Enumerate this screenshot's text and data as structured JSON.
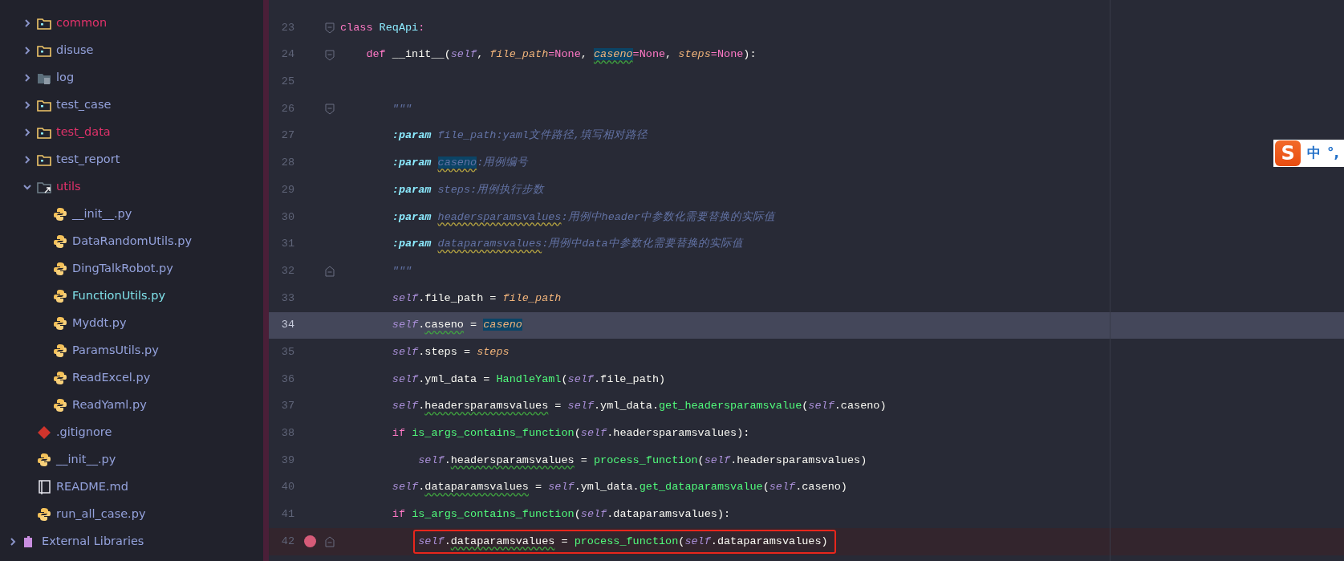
{
  "project_tree": {
    "items": [
      {
        "label": "common",
        "kind": "folder",
        "expanded": false,
        "color": "#e0326a"
      },
      {
        "label": "disuse",
        "kind": "folder",
        "expanded": false,
        "color": "#94a2dc"
      },
      {
        "label": "log",
        "kind": "excluded-folder",
        "expanded": false,
        "color": "#94a2dc"
      },
      {
        "label": "test_case",
        "kind": "folder",
        "expanded": false,
        "color": "#94a2dc"
      },
      {
        "label": "test_data",
        "kind": "folder",
        "expanded": false,
        "color": "#e0326a"
      },
      {
        "label": "test_report",
        "kind": "folder",
        "expanded": false,
        "color": "#94a2dc"
      },
      {
        "label": "utils",
        "kind": "package",
        "expanded": true,
        "color": "#e0326a",
        "children": [
          {
            "label": "__init__.py",
            "kind": "python",
            "color": "#94a2dc"
          },
          {
            "label": "DataRandomUtils.py",
            "kind": "python",
            "color": "#94a2dc"
          },
          {
            "label": "DingTalkRobot.py",
            "kind": "python",
            "color": "#94a2dc"
          },
          {
            "label": "FunctionUtils.py",
            "kind": "python",
            "color": "#7fe0e8"
          },
          {
            "label": "Myddt.py",
            "kind": "python",
            "color": "#94a2dc"
          },
          {
            "label": "ParamsUtils.py",
            "kind": "python",
            "color": "#94a2dc"
          },
          {
            "label": "ReadExcel.py",
            "kind": "python",
            "color": "#94a2dc"
          },
          {
            "label": "ReadYaml.py",
            "kind": "python",
            "color": "#94a2dc"
          }
        ]
      },
      {
        "label": ".gitignore",
        "kind": "git",
        "color": "#94a2dc"
      },
      {
        "label": "__init__.py",
        "kind": "python",
        "color": "#94a2dc"
      },
      {
        "label": "README.md",
        "kind": "markdown",
        "color": "#94a2dc"
      },
      {
        "label": "run_all_case.py",
        "kind": "python",
        "color": "#94a2dc"
      }
    ],
    "external_libraries": {
      "label": "External Libraries",
      "expanded": false
    }
  },
  "editor": {
    "lines": [
      {
        "number": "23",
        "fold_start": true,
        "tokens": [
          {
            "text": "class ",
            "kind": "keyword"
          },
          {
            "text": "ReqApi",
            "kind": "class"
          },
          {
            "text": ":",
            "kind": "keyword"
          }
        ]
      },
      {
        "number": "24",
        "fold_start": true,
        "tokens": [
          {
            "text": "    def",
            "kind": "keyword"
          },
          {
            "text": " __init__(",
            "kind": "plain"
          },
          {
            "text": "self",
            "kind": "self"
          },
          {
            "text": ", ",
            "kind": "plain"
          },
          {
            "text": "file_path",
            "kind": "param"
          },
          {
            "text": "=None",
            "kind": "keyword"
          },
          {
            "text": ", ",
            "kind": "plain"
          },
          {
            "text": "caseno",
            "kind": "param",
            "match": true,
            "squiggle": true
          },
          {
            "text": "=None",
            "kind": "keyword"
          },
          {
            "text": ", ",
            "kind": "plain"
          },
          {
            "text": "steps",
            "kind": "param"
          },
          {
            "text": "=None",
            "kind": "keyword"
          },
          {
            "text": "):",
            "kind": "plain"
          }
        ]
      },
      {
        "number": "25"
      },
      {
        "number": "26",
        "fold_start": true,
        "tokens": [
          {
            "text": "        \"\"\"",
            "kind": "doc"
          }
        ]
      },
      {
        "number": "27",
        "tokens": [
          {
            "text": "        :param",
            "kind": "doctag"
          },
          {
            "text": " file_path:yaml文件路径,填写相对路径",
            "kind": "doc"
          }
        ]
      },
      {
        "number": "28",
        "tokens": [
          {
            "text": "        :param ",
            "kind": "doctag"
          },
          {
            "text": "caseno",
            "kind": "doc",
            "match": true,
            "squiggle": true
          },
          {
            "text": ":用例编号",
            "kind": "doc"
          }
        ]
      },
      {
        "number": "29",
        "tokens": [
          {
            "text": "        :param",
            "kind": "doctag"
          },
          {
            "text": " steps:用例执行步数",
            "kind": "doc"
          }
        ]
      },
      {
        "number": "30",
        "tokens": [
          {
            "text": "        :param ",
            "kind": "doctag"
          },
          {
            "text": "headersparamsvalues",
            "kind": "doc",
            "squiggle": true
          },
          {
            "text": ":用例中header中参数化需要替换的实际值",
            "kind": "doc"
          }
        ]
      },
      {
        "number": "31",
        "tokens": [
          {
            "text": "        :param ",
            "kind": "doctag"
          },
          {
            "text": "dataparamsvalues",
            "kind": "doc",
            "squiggle": true
          },
          {
            "text": ":用例中data中参数化需要替换的实际值",
            "kind": "doc"
          }
        ]
      },
      {
        "number": "32",
        "fold_end": true,
        "tokens": [
          {
            "text": "        \"\"\"",
            "kind": "doc"
          }
        ]
      },
      {
        "number": "33",
        "tokens": [
          {
            "text": "        self",
            "kind": "self"
          },
          {
            "text": ".file_path = ",
            "kind": "plain"
          },
          {
            "text": "file_path",
            "kind": "param"
          }
        ]
      },
      {
        "number": "34",
        "current": true,
        "tokens": [
          {
            "text": "        self",
            "kind": "self"
          },
          {
            "text": ".",
            "kind": "plain"
          },
          {
            "text": "caseno",
            "kind": "plain",
            "squiggle": true
          },
          {
            "text": " = ",
            "kind": "plain"
          },
          {
            "text": "caseno",
            "kind": "param",
            "match": true
          }
        ]
      },
      {
        "number": "35",
        "tokens": [
          {
            "text": "        self",
            "kind": "self"
          },
          {
            "text": ".steps = ",
            "kind": "plain"
          },
          {
            "text": "steps",
            "kind": "param"
          }
        ]
      },
      {
        "number": "36",
        "tokens": [
          {
            "text": "        self",
            "kind": "self"
          },
          {
            "text": ".yml_data = ",
            "kind": "plain"
          },
          {
            "text": "HandleYaml",
            "kind": "function"
          },
          {
            "text": "(",
            "kind": "plain"
          },
          {
            "text": "self",
            "kind": "self"
          },
          {
            "text": ".file_path)",
            "kind": "plain"
          }
        ]
      },
      {
        "number": "37",
        "tokens": [
          {
            "text": "        self",
            "kind": "self"
          },
          {
            "text": ".",
            "kind": "plain"
          },
          {
            "text": "headersparamsvalues",
            "kind": "plain",
            "squiggle": true
          },
          {
            "text": " = ",
            "kind": "plain"
          },
          {
            "text": "self",
            "kind": "self"
          },
          {
            "text": ".yml_data.",
            "kind": "plain"
          },
          {
            "text": "get_headersparamsvalue",
            "kind": "function"
          },
          {
            "text": "(",
            "kind": "plain"
          },
          {
            "text": "self",
            "kind": "self"
          },
          {
            "text": ".caseno)",
            "kind": "plain"
          }
        ]
      },
      {
        "number": "38",
        "tokens": [
          {
            "text": "        if ",
            "kind": "keyword"
          },
          {
            "text": "is_args_contains_function",
            "kind": "function"
          },
          {
            "text": "(",
            "kind": "plain"
          },
          {
            "text": "self",
            "kind": "self"
          },
          {
            "text": ".headersparamsvalues):",
            "kind": "plain"
          }
        ]
      },
      {
        "number": "39",
        "tokens": [
          {
            "text": "            self",
            "kind": "self"
          },
          {
            "text": ".",
            "kind": "plain"
          },
          {
            "text": "headersparamsvalues",
            "kind": "plain",
            "squiggle": true
          },
          {
            "text": " = ",
            "kind": "plain"
          },
          {
            "text": "process_function",
            "kind": "function"
          },
          {
            "text": "(",
            "kind": "plain"
          },
          {
            "text": "self",
            "kind": "self"
          },
          {
            "text": ".headersparamsvalues)",
            "kind": "plain"
          }
        ]
      },
      {
        "number": "40",
        "tokens": [
          {
            "text": "        self",
            "kind": "self"
          },
          {
            "text": ".",
            "kind": "plain"
          },
          {
            "text": "dataparamsvalues",
            "kind": "plain",
            "squiggle": true
          },
          {
            "text": " = ",
            "kind": "plain"
          },
          {
            "text": "self",
            "kind": "self"
          },
          {
            "text": ".yml_data.",
            "kind": "plain"
          },
          {
            "text": "get_dataparamsvalue",
            "kind": "function"
          },
          {
            "text": "(",
            "kind": "plain"
          },
          {
            "text": "self",
            "kind": "self"
          },
          {
            "text": ".caseno)",
            "kind": "plain"
          }
        ]
      },
      {
        "number": "41",
        "tokens": [
          {
            "text": "        if ",
            "kind": "keyword"
          },
          {
            "text": "is_args_contains_function",
            "kind": "function"
          },
          {
            "text": "(",
            "kind": "plain"
          },
          {
            "text": "self",
            "kind": "self"
          },
          {
            "text": ".dataparamsvalues):",
            "kind": "plain"
          }
        ]
      },
      {
        "number": "42",
        "breakpoint": true,
        "boxed": true,
        "fold_end": true,
        "tokens": [
          {
            "text": "            self",
            "kind": "self"
          },
          {
            "text": ".",
            "kind": "plain"
          },
          {
            "text": "dataparamsvalues",
            "kind": "plain",
            "squiggle": true
          },
          {
            "text": " = ",
            "kind": "plain"
          },
          {
            "text": "process_function",
            "kind": "function"
          },
          {
            "text": "(",
            "kind": "plain"
          },
          {
            "text": "self",
            "kind": "self"
          },
          {
            "text": ".dataparamsvalues)",
            "kind": "plain"
          }
        ]
      }
    ]
  },
  "ime_toolbar": {
    "logo": "S",
    "mode": "中",
    "punctuation": "°,"
  }
}
